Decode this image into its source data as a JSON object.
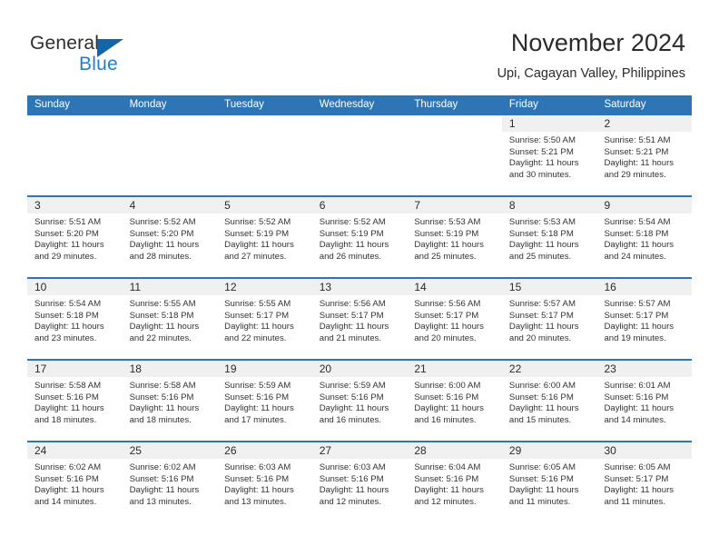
{
  "brand": {
    "name_part1": "General",
    "name_part2": "Blue",
    "accent_color": "#1f7fd0",
    "triangle_color": "#1464aa"
  },
  "header": {
    "title": "November 2024",
    "subtitle": "Upi, Cagayan Valley, Philippines"
  },
  "theme": {
    "header_blue": "#2e75b6",
    "daynum_band": "#f0f0f0"
  },
  "weekdays": [
    "Sunday",
    "Monday",
    "Tuesday",
    "Wednesday",
    "Thursday",
    "Friday",
    "Saturday"
  ],
  "weeks": [
    [
      {
        "day": "",
        "sunrise": "",
        "sunset": "",
        "daylight_line1": "",
        "daylight_line2": ""
      },
      {
        "day": "",
        "sunrise": "",
        "sunset": "",
        "daylight_line1": "",
        "daylight_line2": ""
      },
      {
        "day": "",
        "sunrise": "",
        "sunset": "",
        "daylight_line1": "",
        "daylight_line2": ""
      },
      {
        "day": "",
        "sunrise": "",
        "sunset": "",
        "daylight_line1": "",
        "daylight_line2": ""
      },
      {
        "day": "",
        "sunrise": "",
        "sunset": "",
        "daylight_line1": "",
        "daylight_line2": ""
      },
      {
        "day": "1",
        "sunrise": "Sunrise: 5:50 AM",
        "sunset": "Sunset: 5:21 PM",
        "daylight_line1": "Daylight: 11 hours",
        "daylight_line2": "and 30 minutes."
      },
      {
        "day": "2",
        "sunrise": "Sunrise: 5:51 AM",
        "sunset": "Sunset: 5:21 PM",
        "daylight_line1": "Daylight: 11 hours",
        "daylight_line2": "and 29 minutes."
      }
    ],
    [
      {
        "day": "3",
        "sunrise": "Sunrise: 5:51 AM",
        "sunset": "Sunset: 5:20 PM",
        "daylight_line1": "Daylight: 11 hours",
        "daylight_line2": "and 29 minutes."
      },
      {
        "day": "4",
        "sunrise": "Sunrise: 5:52 AM",
        "sunset": "Sunset: 5:20 PM",
        "daylight_line1": "Daylight: 11 hours",
        "daylight_line2": "and 28 minutes."
      },
      {
        "day": "5",
        "sunrise": "Sunrise: 5:52 AM",
        "sunset": "Sunset: 5:19 PM",
        "daylight_line1": "Daylight: 11 hours",
        "daylight_line2": "and 27 minutes."
      },
      {
        "day": "6",
        "sunrise": "Sunrise: 5:52 AM",
        "sunset": "Sunset: 5:19 PM",
        "daylight_line1": "Daylight: 11 hours",
        "daylight_line2": "and 26 minutes."
      },
      {
        "day": "7",
        "sunrise": "Sunrise: 5:53 AM",
        "sunset": "Sunset: 5:19 PM",
        "daylight_line1": "Daylight: 11 hours",
        "daylight_line2": "and 25 minutes."
      },
      {
        "day": "8",
        "sunrise": "Sunrise: 5:53 AM",
        "sunset": "Sunset: 5:18 PM",
        "daylight_line1": "Daylight: 11 hours",
        "daylight_line2": "and 25 minutes."
      },
      {
        "day": "9",
        "sunrise": "Sunrise: 5:54 AM",
        "sunset": "Sunset: 5:18 PM",
        "daylight_line1": "Daylight: 11 hours",
        "daylight_line2": "and 24 minutes."
      }
    ],
    [
      {
        "day": "10",
        "sunrise": "Sunrise: 5:54 AM",
        "sunset": "Sunset: 5:18 PM",
        "daylight_line1": "Daylight: 11 hours",
        "daylight_line2": "and 23 minutes."
      },
      {
        "day": "11",
        "sunrise": "Sunrise: 5:55 AM",
        "sunset": "Sunset: 5:18 PM",
        "daylight_line1": "Daylight: 11 hours",
        "daylight_line2": "and 22 minutes."
      },
      {
        "day": "12",
        "sunrise": "Sunrise: 5:55 AM",
        "sunset": "Sunset: 5:17 PM",
        "daylight_line1": "Daylight: 11 hours",
        "daylight_line2": "and 22 minutes."
      },
      {
        "day": "13",
        "sunrise": "Sunrise: 5:56 AM",
        "sunset": "Sunset: 5:17 PM",
        "daylight_line1": "Daylight: 11 hours",
        "daylight_line2": "and 21 minutes."
      },
      {
        "day": "14",
        "sunrise": "Sunrise: 5:56 AM",
        "sunset": "Sunset: 5:17 PM",
        "daylight_line1": "Daylight: 11 hours",
        "daylight_line2": "and 20 minutes."
      },
      {
        "day": "15",
        "sunrise": "Sunrise: 5:57 AM",
        "sunset": "Sunset: 5:17 PM",
        "daylight_line1": "Daylight: 11 hours",
        "daylight_line2": "and 20 minutes."
      },
      {
        "day": "16",
        "sunrise": "Sunrise: 5:57 AM",
        "sunset": "Sunset: 5:17 PM",
        "daylight_line1": "Daylight: 11 hours",
        "daylight_line2": "and 19 minutes."
      }
    ],
    [
      {
        "day": "17",
        "sunrise": "Sunrise: 5:58 AM",
        "sunset": "Sunset: 5:16 PM",
        "daylight_line1": "Daylight: 11 hours",
        "daylight_line2": "and 18 minutes."
      },
      {
        "day": "18",
        "sunrise": "Sunrise: 5:58 AM",
        "sunset": "Sunset: 5:16 PM",
        "daylight_line1": "Daylight: 11 hours",
        "daylight_line2": "and 18 minutes."
      },
      {
        "day": "19",
        "sunrise": "Sunrise: 5:59 AM",
        "sunset": "Sunset: 5:16 PM",
        "daylight_line1": "Daylight: 11 hours",
        "daylight_line2": "and 17 minutes."
      },
      {
        "day": "20",
        "sunrise": "Sunrise: 5:59 AM",
        "sunset": "Sunset: 5:16 PM",
        "daylight_line1": "Daylight: 11 hours",
        "daylight_line2": "and 16 minutes."
      },
      {
        "day": "21",
        "sunrise": "Sunrise: 6:00 AM",
        "sunset": "Sunset: 5:16 PM",
        "daylight_line1": "Daylight: 11 hours",
        "daylight_line2": "and 16 minutes."
      },
      {
        "day": "22",
        "sunrise": "Sunrise: 6:00 AM",
        "sunset": "Sunset: 5:16 PM",
        "daylight_line1": "Daylight: 11 hours",
        "daylight_line2": "and 15 minutes."
      },
      {
        "day": "23",
        "sunrise": "Sunrise: 6:01 AM",
        "sunset": "Sunset: 5:16 PM",
        "daylight_line1": "Daylight: 11 hours",
        "daylight_line2": "and 14 minutes."
      }
    ],
    [
      {
        "day": "24",
        "sunrise": "Sunrise: 6:02 AM",
        "sunset": "Sunset: 5:16 PM",
        "daylight_line1": "Daylight: 11 hours",
        "daylight_line2": "and 14 minutes."
      },
      {
        "day": "25",
        "sunrise": "Sunrise: 6:02 AM",
        "sunset": "Sunset: 5:16 PM",
        "daylight_line1": "Daylight: 11 hours",
        "daylight_line2": "and 13 minutes."
      },
      {
        "day": "26",
        "sunrise": "Sunrise: 6:03 AM",
        "sunset": "Sunset: 5:16 PM",
        "daylight_line1": "Daylight: 11 hours",
        "daylight_line2": "and 13 minutes."
      },
      {
        "day": "27",
        "sunrise": "Sunrise: 6:03 AM",
        "sunset": "Sunset: 5:16 PM",
        "daylight_line1": "Daylight: 11 hours",
        "daylight_line2": "and 12 minutes."
      },
      {
        "day": "28",
        "sunrise": "Sunrise: 6:04 AM",
        "sunset": "Sunset: 5:16 PM",
        "daylight_line1": "Daylight: 11 hours",
        "daylight_line2": "and 12 minutes."
      },
      {
        "day": "29",
        "sunrise": "Sunrise: 6:05 AM",
        "sunset": "Sunset: 5:16 PM",
        "daylight_line1": "Daylight: 11 hours",
        "daylight_line2": "and 11 minutes."
      },
      {
        "day": "30",
        "sunrise": "Sunrise: 6:05 AM",
        "sunset": "Sunset: 5:17 PM",
        "daylight_line1": "Daylight: 11 hours",
        "daylight_line2": "and 11 minutes."
      }
    ]
  ]
}
